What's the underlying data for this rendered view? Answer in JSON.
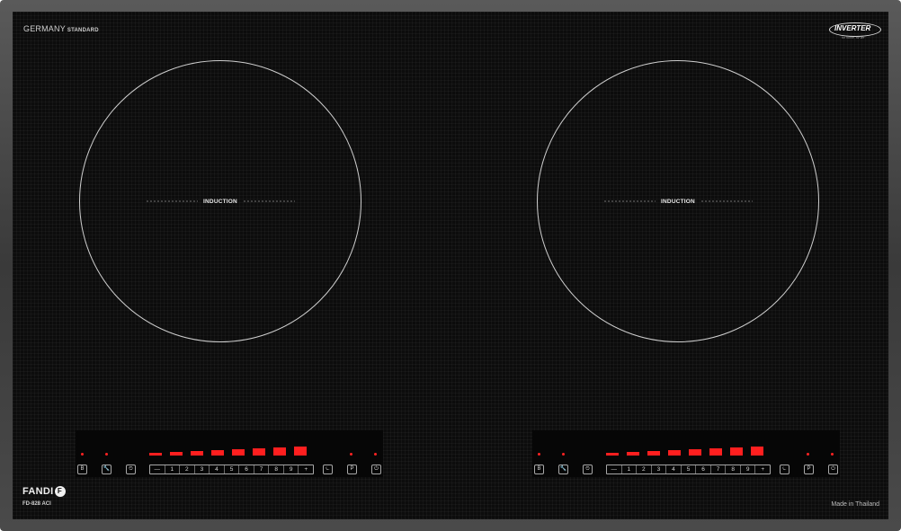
{
  "brand_top": {
    "main": "GERMANY",
    "suffix": "STANDARD"
  },
  "inverter_badge": {
    "text": "INVERTER",
    "tagline": "for home, for life"
  },
  "zones": [
    {
      "label": "INDUCTION"
    },
    {
      "label": "INDUCTION"
    }
  ],
  "controls": {
    "left_buttons": [
      "B",
      "🔧",
      "⏲"
    ],
    "slider_levels": [
      "—",
      "1",
      "2",
      "3",
      "4",
      "5",
      "6",
      "7",
      "8",
      "9",
      "+"
    ],
    "right_buttons": [
      "⏾",
      "P",
      "⏻"
    ]
  },
  "brand_bottom": {
    "name": "FANDI",
    "logo_letter": "F",
    "model": "FD-828 ACI"
  },
  "made_in": "Made in Thailand"
}
